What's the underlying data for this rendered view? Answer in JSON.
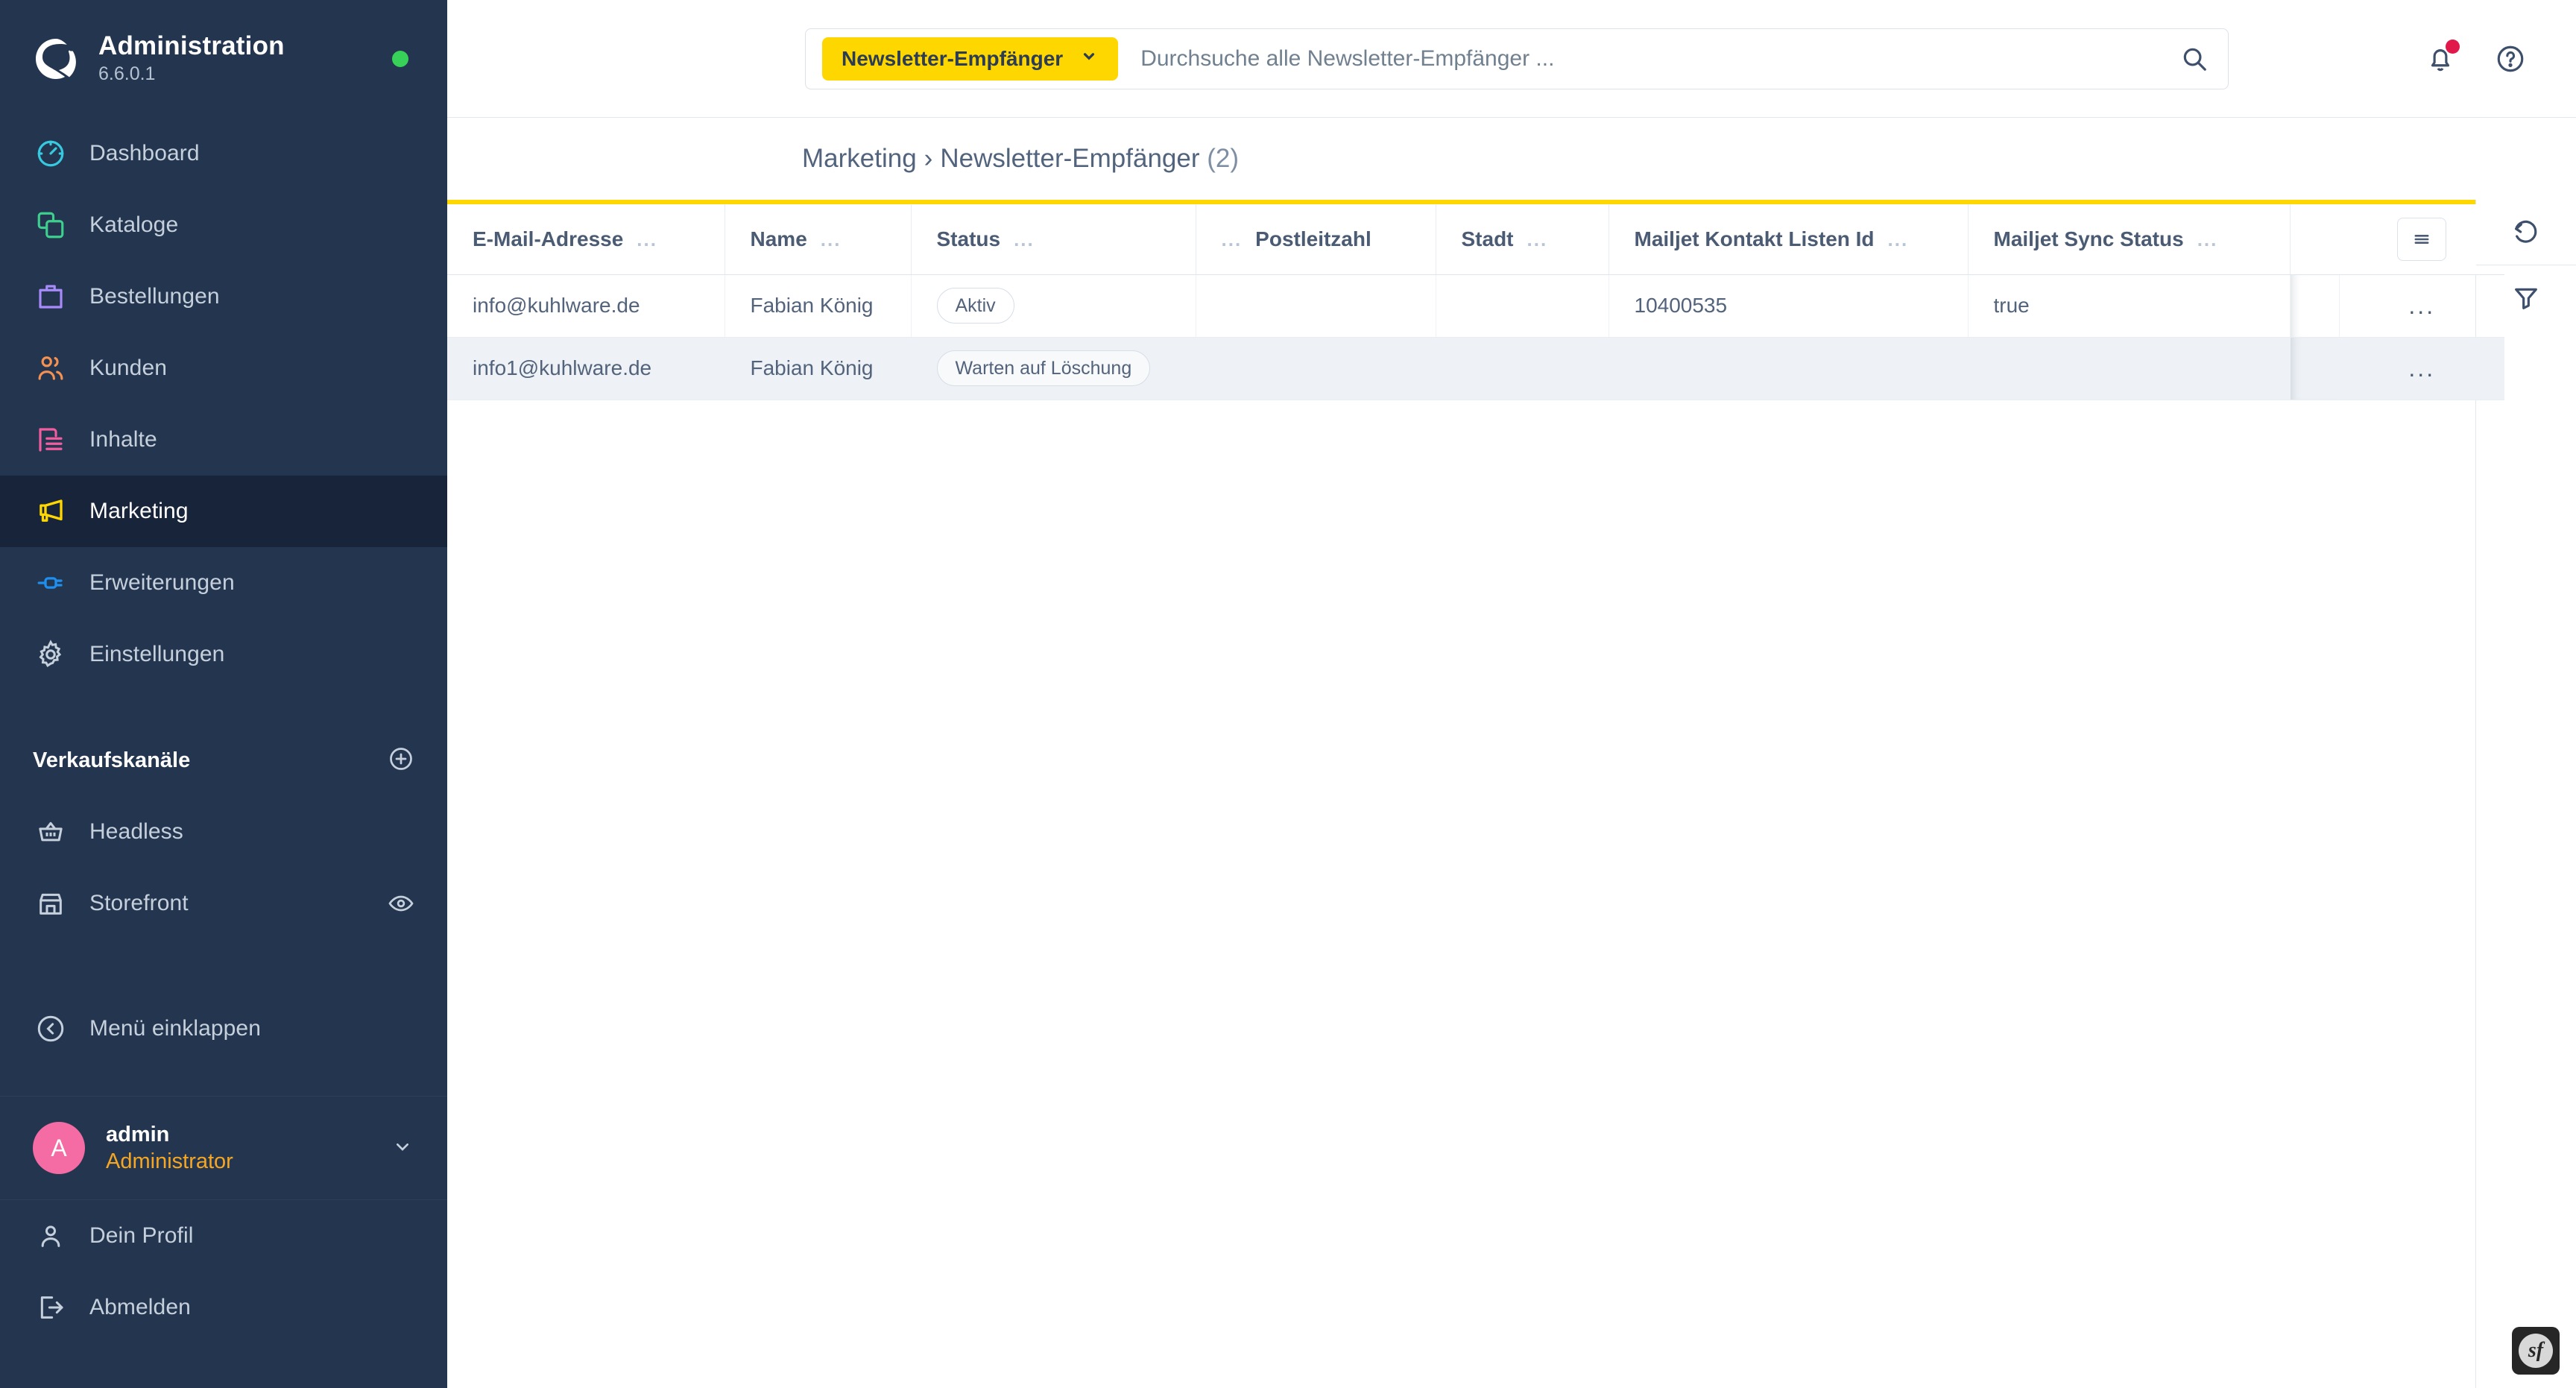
{
  "sidebar": {
    "brand": {
      "title": "Administration",
      "version": "6.6.0.1",
      "status_dot_color": "#37d058",
      "logo_icon": "shopware-logo-icon"
    },
    "items": [
      {
        "label": "Dashboard",
        "icon": "gauge-icon",
        "color": "#37c9e0",
        "active": false
      },
      {
        "label": "Kataloge",
        "icon": "copy-icon",
        "color": "#3ecf8e",
        "active": false
      },
      {
        "label": "Bestellungen",
        "icon": "bag-icon",
        "color": "#a78bfa",
        "active": false
      },
      {
        "label": "Kunden",
        "icon": "users-icon",
        "color": "#f59151",
        "active": false
      },
      {
        "label": "Inhalte",
        "icon": "content-icon",
        "color": "#f25da0",
        "active": false
      },
      {
        "label": "Marketing",
        "icon": "megaphone-icon",
        "color": "#ffd700",
        "active": true
      },
      {
        "label": "Erweiterungen",
        "icon": "plug-icon",
        "color": "#1e8fee",
        "active": false
      },
      {
        "label": "Einstellungen",
        "icon": "gear-icon",
        "color": "#c6d0dc",
        "active": false
      }
    ],
    "section": {
      "title": "Verkaufskanäle",
      "add_icon": "plus-circle-icon"
    },
    "channels": [
      {
        "label": "Headless",
        "icon": "basket-icon",
        "trail_icon": ""
      },
      {
        "label": "Storefront",
        "icon": "store-icon",
        "trail_icon": "eye-icon"
      }
    ],
    "collapse": {
      "label": "Menü einklappen",
      "icon": "chevron-left-circle-icon"
    },
    "user": {
      "initial": "A",
      "name": "admin",
      "role": "Administrator",
      "chevron_icon": "chevron-down-icon"
    },
    "footer": [
      {
        "label": "Dein Profil",
        "icon": "user-icon"
      },
      {
        "label": "Abmelden",
        "icon": "logout-icon"
      }
    ]
  },
  "topbar": {
    "context_pill": {
      "label": "Newsletter-Empfänger",
      "chevron_icon": "chevron-down-icon"
    },
    "search": {
      "value": "",
      "placeholder": "Durchsuche alle Newsletter-Empfänger ...",
      "icon": "search-icon"
    },
    "actions": [
      {
        "name": "notifications-button",
        "icon": "bell-icon",
        "badge": true,
        "badge_color": "#e1194b"
      },
      {
        "name": "help-button",
        "icon": "help-circle-icon",
        "badge": false
      }
    ]
  },
  "page": {
    "breadcrumb_parent": "Marketing",
    "breadcrumb_sep": "›",
    "breadcrumb_current": "Newsletter-Empfänger",
    "count": "(2)",
    "accent_color": "#ffd700"
  },
  "table": {
    "columns": [
      {
        "label": "E-Mail-Adresse",
        "align": "left",
        "menu": "..."
      },
      {
        "label": "Name",
        "align": "left",
        "menu": "..."
      },
      {
        "label": "Status",
        "align": "left",
        "menu": "..."
      },
      {
        "label": "Postleitzahl",
        "align": "right",
        "menu": "..."
      },
      {
        "label": "Stadt",
        "align": "left",
        "menu": "..."
      },
      {
        "label": "Mailjet Kontakt Listen Id",
        "align": "left",
        "menu": "..."
      },
      {
        "label": "Mailjet Sync Status",
        "align": "left",
        "menu": "..."
      }
    ],
    "settings_button_icon": "list-settings-icon",
    "rows": [
      {
        "email": "info@kuhlware.de",
        "name": "Fabian König",
        "status": "Aktiv",
        "postleitzahl": "",
        "stadt": "",
        "mailjet_list_id": "10400535",
        "mailjet_sync_status": "true",
        "actions": "..."
      },
      {
        "email": "info1@kuhlware.de",
        "name": "Fabian König",
        "status": "Warten auf Löschung",
        "postleitzahl": "",
        "stadt": "",
        "mailjet_list_id": "",
        "mailjet_sync_status": "",
        "actions": "..."
      }
    ]
  },
  "rail": {
    "buttons": [
      {
        "name": "refresh-button",
        "icon": "refresh-icon"
      },
      {
        "name": "filter-button",
        "icon": "filter-icon"
      }
    ]
  },
  "debug_toolbar": {
    "label": "sf",
    "icon": "symfony-icon"
  }
}
